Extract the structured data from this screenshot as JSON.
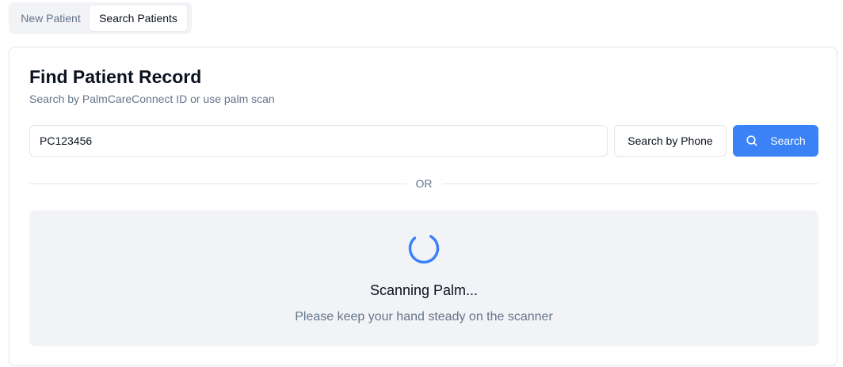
{
  "tabs": {
    "items": [
      {
        "label": "New Patient",
        "active": false
      },
      {
        "label": "Search Patients",
        "active": true
      }
    ]
  },
  "card": {
    "title": "Find Patient Record",
    "subtitle": "Search by PalmCareConnect ID or use palm scan"
  },
  "search": {
    "value": "PC123456",
    "phone_button": "Search by Phone",
    "search_button": "Search",
    "search_icon": "search-icon"
  },
  "divider": {
    "label": "OR"
  },
  "scan": {
    "title": "Scanning Palm...",
    "message": "Please keep your hand steady on the scanner",
    "spinner_icon": "loading-spinner-icon"
  },
  "colors": {
    "accent": "#3b82f6",
    "muted_text": "#64748b",
    "panel_bg": "#f1f3f6",
    "border": "#e2e5ea"
  }
}
